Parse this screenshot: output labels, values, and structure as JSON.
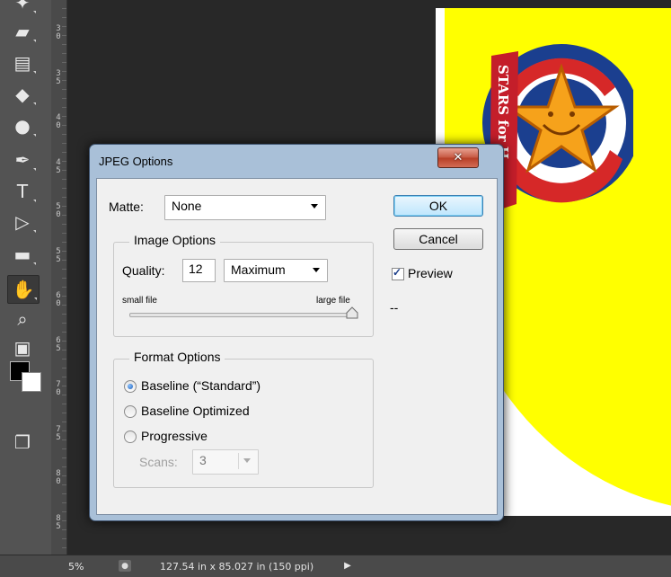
{
  "toolbar": {
    "tools": [
      {
        "icon": "brush-partial-icon",
        "glyph": "✦",
        "active": false
      },
      {
        "icon": "eraser-icon",
        "glyph": "▰",
        "active": false
      },
      {
        "icon": "gradient-icon",
        "glyph": "▤",
        "active": false
      },
      {
        "icon": "blur-drop-icon",
        "glyph": "◆",
        "active": false
      },
      {
        "icon": "dodge-icon",
        "glyph": "●",
        "active": false
      },
      {
        "icon": "pen-icon",
        "glyph": "✒",
        "active": false
      },
      {
        "icon": "type-icon",
        "glyph": "T",
        "active": false
      },
      {
        "icon": "path-selection-icon",
        "glyph": "▷",
        "active": false
      },
      {
        "icon": "rectangle-shape-icon",
        "glyph": "▬",
        "active": false
      },
      {
        "icon": "hand-icon",
        "glyph": "✋",
        "active": true
      },
      {
        "icon": "zoom-icon",
        "glyph": "⌕",
        "active": false
      },
      {
        "icon": "quick-mask-icon",
        "glyph": "▣",
        "active": false
      },
      {
        "icon": "screen-mode-icon",
        "glyph": "❐",
        "active": false
      }
    ],
    "colors": {
      "foreground": "#000000",
      "background": "#ffffff"
    }
  },
  "ruler": {
    "labels": [
      "3\n0",
      "3\n5",
      "4\n0",
      "4\n5",
      "5\n0",
      "5\n5",
      "6\n0",
      "6\n5",
      "7\n0",
      "7\n5",
      "8\n0",
      "8\n5"
    ]
  },
  "canvas": {
    "document_color": "#ffff00",
    "logo_text": "STARS for H"
  },
  "dialog": {
    "title": "JPEG Options",
    "close_glyph": "✕",
    "matte": {
      "label": "Matte:",
      "value": "None"
    },
    "image_options": {
      "title": "Image Options",
      "quality_label": "Quality:",
      "quality_value": "12",
      "quality_preset": "Maximum",
      "small_label": "small file",
      "large_label": "large file",
      "slider_value": 1.0
    },
    "format_options": {
      "title": "Format Options",
      "choices": [
        {
          "label": "Baseline (“Standard”)",
          "checked": true
        },
        {
          "label": "Baseline Optimized",
          "checked": false
        },
        {
          "label": "Progressive",
          "checked": false
        }
      ],
      "scans_label": "Scans:",
      "scans_value": "3"
    },
    "ok_label": "OK",
    "cancel_label": "Cancel",
    "preview_label": "Preview",
    "preview_checked": true,
    "size_readout": "--"
  },
  "statusbar": {
    "zoom": "5%",
    "doc_info": "127.54 in x 85.027 in (150 ppi)"
  }
}
